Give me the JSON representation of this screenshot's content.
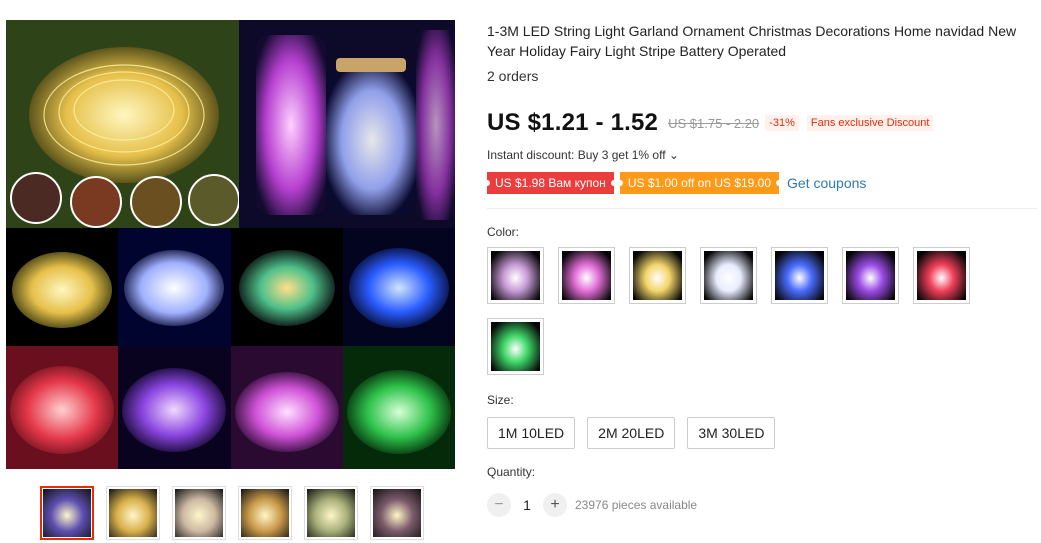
{
  "product": {
    "title": "1-3M LED String Light Garland Ornament Christmas Decorations Home navidad New Year Holiday Fairy Light Stripe Battery Operated",
    "orders": "2 orders"
  },
  "pricing": {
    "price": "US $1.21 - 1.52",
    "old_price": "US $1.75 - 2.20",
    "discount": "-31%",
    "fans_badge": "Fans exclusive Discount",
    "instant_discount": "Instant discount: Buy 3 get 1% off",
    "instant_discount_chevron": "⌄"
  },
  "coupons": {
    "items": [
      {
        "label": "US $1.98 Вам купон",
        "color": "#ec3d3d"
      },
      {
        "label": "US $1.00 off on US $19.00",
        "color": "#ff9a18"
      }
    ],
    "get_coupons": "Get coupons"
  },
  "color": {
    "label": "Color:",
    "swatches": [
      {
        "name": "multicolor",
        "hex": "#c79bd6"
      },
      {
        "name": "pink",
        "hex": "#e36fd8"
      },
      {
        "name": "warm-white",
        "hex": "#f3d56a"
      },
      {
        "name": "white",
        "hex": "#e8ecff"
      },
      {
        "name": "blue",
        "hex": "#4a6cff"
      },
      {
        "name": "purple",
        "hex": "#9b4ce6"
      },
      {
        "name": "red",
        "hex": "#f0405a"
      },
      {
        "name": "green",
        "hex": "#3fd768"
      }
    ]
  },
  "size": {
    "label": "Size:",
    "options": [
      "1M 10LED",
      "2M 20LED",
      "3M 30LED"
    ]
  },
  "quantity": {
    "label": "Quantity:",
    "minus": "−",
    "value": "1",
    "plus": "+",
    "available": "23976 pieces available"
  },
  "gallery": {
    "thumbnails": [
      {
        "name": "thumb-multicolor-grid",
        "hex": "#5c4fb0",
        "active": true
      },
      {
        "name": "thumb-warm-coil",
        "hex": "#d9b14c",
        "active": false
      },
      {
        "name": "thumb-beige-dots",
        "hex": "#cdb9a4",
        "active": false
      },
      {
        "name": "thumb-jars",
        "hex": "#c99a4a",
        "active": false
      },
      {
        "name": "thumb-green-coil",
        "hex": "#a8b07a",
        "active": false
      },
      {
        "name": "thumb-collage",
        "hex": "#7a5a6a",
        "active": false
      }
    ]
  },
  "colors": {
    "price_text": "#111111",
    "accent_red": "#e62e04",
    "link_blue": "#2e7bb3"
  }
}
